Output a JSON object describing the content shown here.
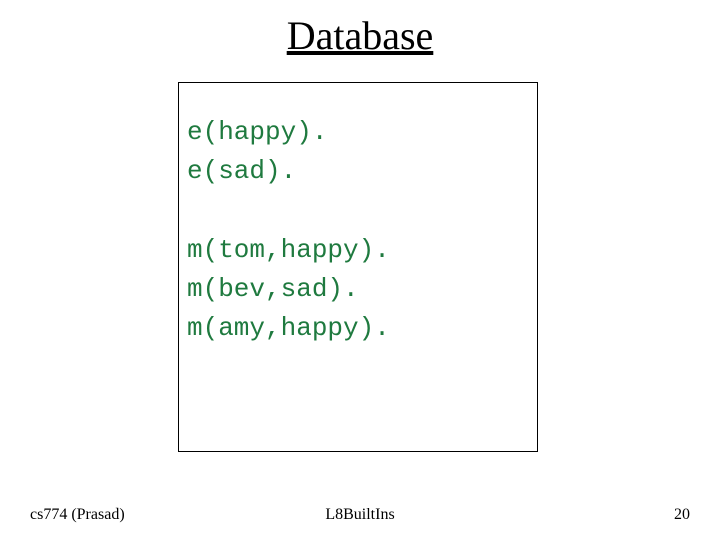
{
  "title": "Database",
  "code": {
    "block1": [
      "e(happy).",
      "e(sad)."
    ],
    "block2": [
      "m(tom,happy).",
      "m(bev,sad).",
      "m(amy,happy)."
    ]
  },
  "footer": {
    "left": "cs774 (Prasad)",
    "center": "L8BuiltIns",
    "right": "20"
  }
}
